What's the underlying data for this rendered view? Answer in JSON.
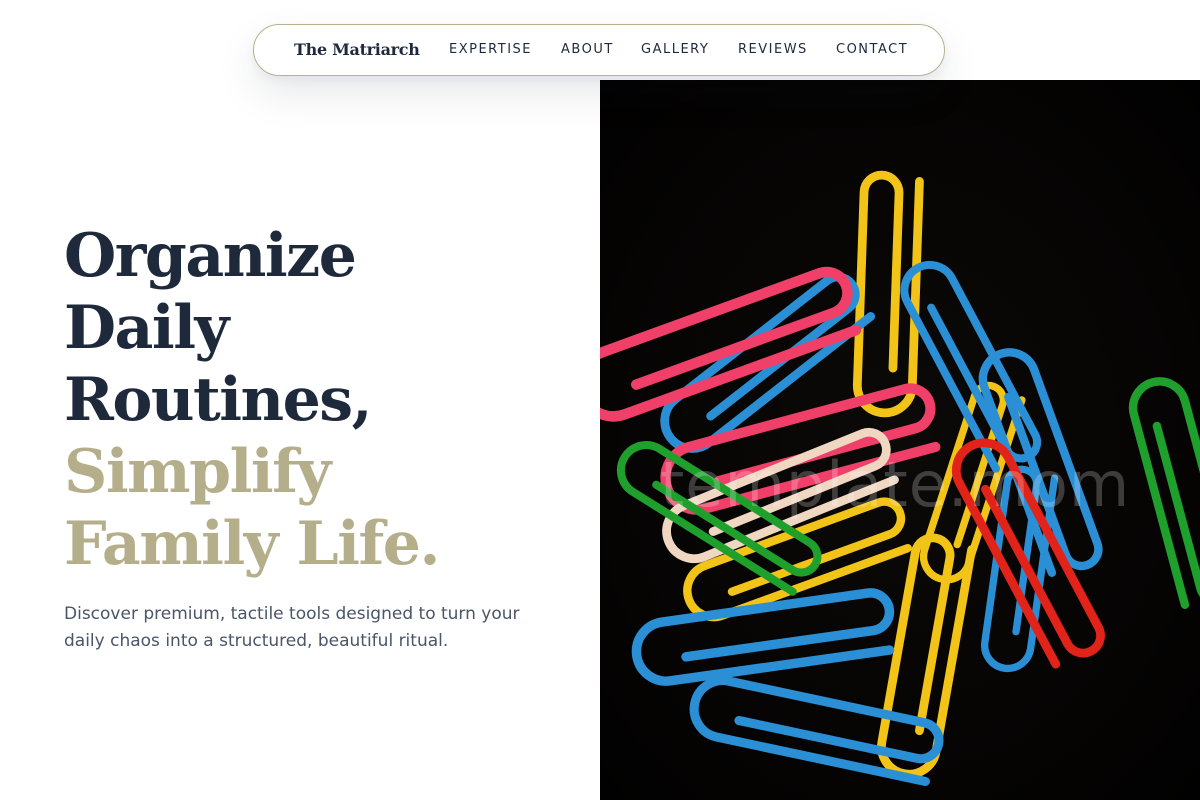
{
  "nav": {
    "brand": "The Matriarch",
    "links": [
      {
        "label": "EXPERTISE"
      },
      {
        "label": "ABOUT"
      },
      {
        "label": "GALLERY"
      },
      {
        "label": "REVIEWS"
      },
      {
        "label": "CONTACT"
      }
    ]
  },
  "hero": {
    "headline_lines": [
      "Organize",
      "Daily",
      "Routines,"
    ],
    "accent_lines": [
      "Simplify",
      "Family Life."
    ],
    "subtext": "Discover premium, tactile tools designed to turn your daily chaos into a structured, beautiful ritual.",
    "image": {
      "subject": "colorful paperclips on black background",
      "watermark": "template.mom"
    }
  },
  "colors": {
    "navy": "#1e2a3c",
    "accent": "#b5ae8b",
    "body_text": "#4a5568",
    "nav_border": "#b9b28e",
    "image_bg": "#030202",
    "clip_yellow": "#f3c418",
    "clip_blue": "#2b8fd6",
    "clip_pink": "#f0406a",
    "clip_red": "#e2231a",
    "clip_green": "#1fa02c",
    "clip_cream": "#f0d7c2"
  }
}
